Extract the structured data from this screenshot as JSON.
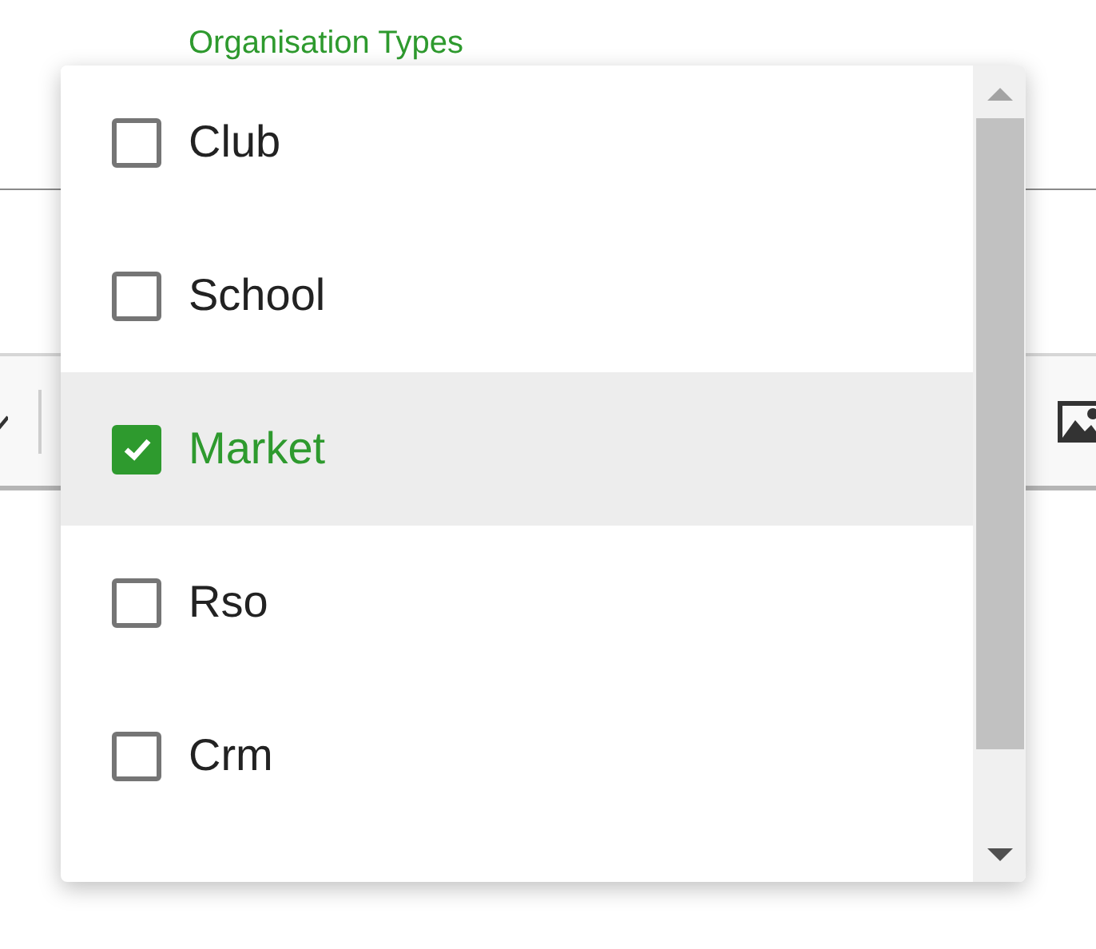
{
  "field": {
    "label": "Organisation Types"
  },
  "options": [
    {
      "label": "Club",
      "checked": false,
      "highlighted": false
    },
    {
      "label": "School",
      "checked": false,
      "highlighted": false
    },
    {
      "label": "Market",
      "checked": true,
      "highlighted": true
    },
    {
      "label": "Rso",
      "checked": false,
      "highlighted": false
    },
    {
      "label": "Crm",
      "checked": false,
      "highlighted": false
    }
  ]
}
